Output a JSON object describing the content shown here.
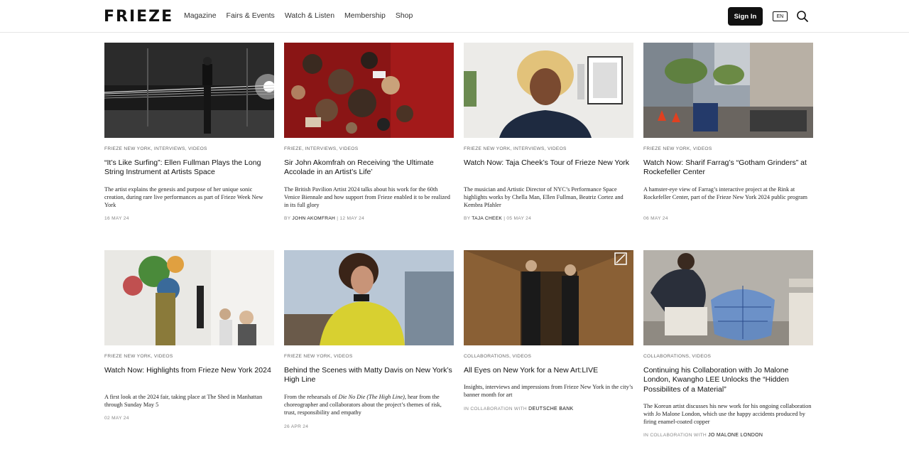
{
  "header": {
    "logo": "FRIEZE",
    "nav": [
      "Magazine",
      "Fairs & Events",
      "Watch & Listen",
      "Membership",
      "Shop"
    ],
    "signin_label": "Sign In",
    "lang_label": "EN"
  },
  "cards": [
    {
      "tags": "FRIEZE NEW YORK, INTERVIEWS, VIDEOS",
      "title": "“It’s Like Surfing”: Ellen Fullman Plays the Long String Instrument at Artists Space",
      "desc": "The artist explains the genesis and purpose of her unique sonic creation, during rare live performances as part of Frieze Week New York",
      "meta_prefix": "",
      "meta_strong": "",
      "meta_suffix": "16 MAY 24"
    },
    {
      "tags": "FRIEZE, INTERVIEWS, VIDEOS",
      "title": "Sir John Akomfrah on Receiving ‘the Ultimate Accolade in an Artist’s Life’",
      "desc": "The British Pavilion Artist 2024 talks about his work for the 60th Venice Biennale and how support from Frieze enabled it to be realized in its full glory",
      "meta_prefix": "BY ",
      "meta_strong": "JOHN AKOMFRAH",
      "meta_suffix": " | 12 MAY 24"
    },
    {
      "tags": "FRIEZE NEW YORK, INTERVIEWS, VIDEOS",
      "title": "Watch Now: Taja Cheek’s Tour of Frieze New York",
      "desc": "The musician and Artistic Director of NYC’s Performance Space highlights works by Chella Man, Ellen Fullman, Beatriz Cortez and Kembra Pfahler",
      "meta_prefix": "BY ",
      "meta_strong": "TAJA CHEEK",
      "meta_suffix": " | 05 MAY 24"
    },
    {
      "tags": "FRIEZE NEW YORK, VIDEOS",
      "title": "Watch Now: Sharif Farrag’s “Gotham Grinders” at Rockefeller Center",
      "desc": "A hamster-eye view of Farrag’s interactive project at the Rink at Rockefeller Center, part of the Frieze New York 2024 public program",
      "meta_prefix": "",
      "meta_strong": "",
      "meta_suffix": "06 MAY 24"
    },
    {
      "tags": "FRIEZE NEW YORK, VIDEOS",
      "title": "Watch Now: Highlights from Frieze New York 2024",
      "desc": "A first look at the 2024 fair, taking place at The Shed in Manhattan through Sunday May 5",
      "meta_prefix": "",
      "meta_strong": "",
      "meta_suffix": "02 MAY 24"
    },
    {
      "tags": "FRIEZE NEW YORK, VIDEOS",
      "title": "Behind the Scenes with Matty Davis on New York’s High Line",
      "desc_a": "From the rehearsals of ",
      "desc_em": "Die No Die (The High Line)",
      "desc_b": ", hear from the choreographer and collaborators about the project’s themes of risk, trust, responsibility and empathy",
      "meta_prefix": "",
      "meta_strong": "",
      "meta_suffix": "26 APR 24"
    },
    {
      "tags": "COLLABORATIONS, VIDEOS",
      "title": "All Eyes on New York for a New Art:LIVE",
      "desc": "Insights, interviews and impressions from Frieze New York in the city’s banner month for art",
      "meta_prefix": "IN COLLABORATION WITH ",
      "meta_strong": "DEUTSCHE BANK",
      "meta_suffix": ""
    },
    {
      "tags": "COLLABORATIONS, VIDEOS",
      "title": "Continuing his Collaboration with Jo Malone London, Kwangho LEE Unlocks the “Hidden Possibilites of a Material”",
      "desc": "The Korean artist discusses his new work for his ongoing collaboration with Jo Malone London, which use the happy accidents produced by firing enamel-coated copper",
      "meta_prefix": "IN COLLABORATION WITH ",
      "meta_strong": "JO MALONE LONDON",
      "meta_suffix": ""
    }
  ]
}
